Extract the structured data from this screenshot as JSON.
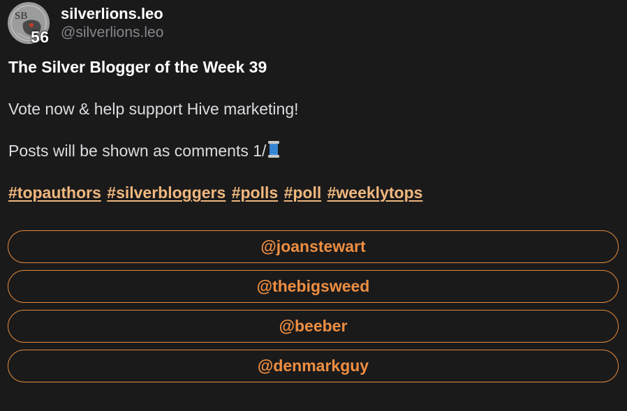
{
  "author": {
    "display_name": "silverlions.leo",
    "handle": "@silverlions.leo",
    "level": "56",
    "avatar_monogram": "SB"
  },
  "post": {
    "title": "The Silver Blogger of the Week 39",
    "paragraph_1": "Vote now & help support Hive marketing!",
    "paragraph_2": "Posts will be shown as comments 1/",
    "paragraph_2_emoji": "spool-of-thread-icon",
    "hashtags": [
      "#topauthors",
      "#silverbloggers",
      "#polls",
      "#poll",
      "#weeklytops"
    ]
  },
  "poll": {
    "options": [
      "@joanstewart",
      "@thebigsweed",
      "@beeber",
      "@denmarkguy"
    ]
  },
  "colors": {
    "background": "#1a1a1b",
    "hashtag": "#f0b77e",
    "poll_accent": "#ee8e41",
    "handle": "#86868d"
  }
}
